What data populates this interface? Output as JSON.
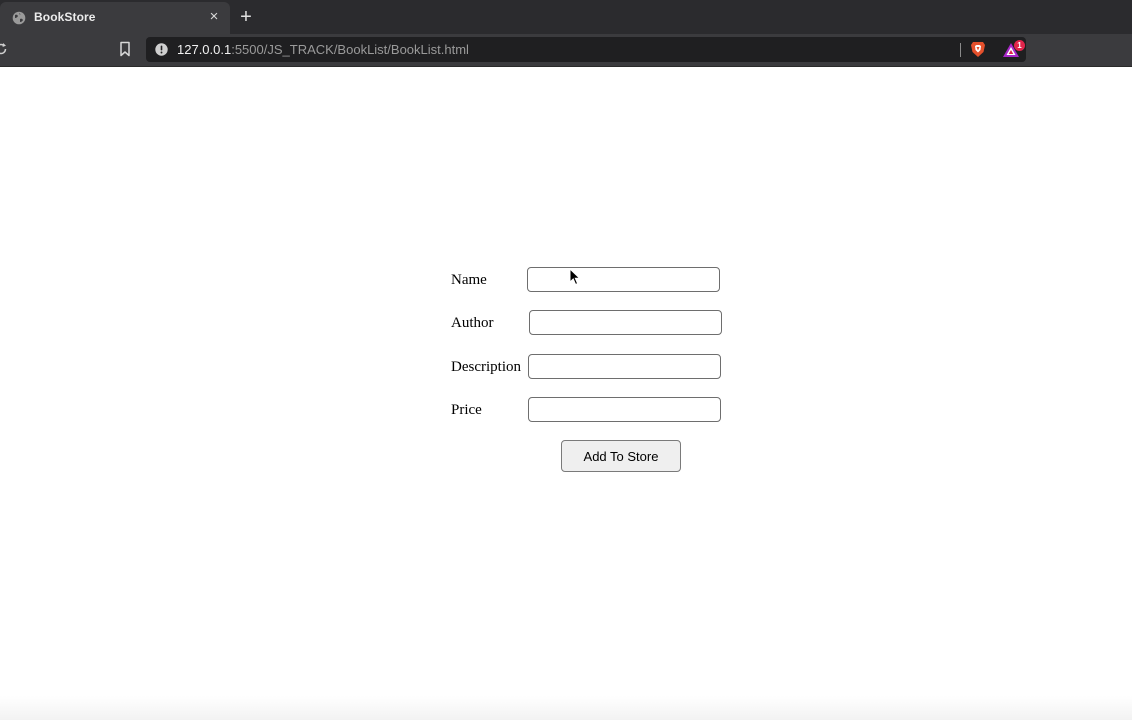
{
  "browser": {
    "tab": {
      "title": "BookStore",
      "close_glyph": "×",
      "favicon": "globe-icon"
    },
    "new_tab_glyph": "+",
    "url": {
      "host": "127.0.0.1",
      "rest": ":5500/JS_TRACK/BookList/BookList.html"
    },
    "rewards_badge": "1",
    "icons": [
      "reload-icon",
      "bookmark-icon",
      "info-icon",
      "brave-shield-icon",
      "brave-rewards-icon"
    ]
  },
  "form": {
    "fields": [
      {
        "label": "Name",
        "value": "",
        "placeholder": ""
      },
      {
        "label": "Author",
        "value": "",
        "placeholder": ""
      },
      {
        "label": "Description",
        "value": "",
        "placeholder": ""
      },
      {
        "label": "Price",
        "value": "",
        "placeholder": ""
      }
    ],
    "submit_label": "Add To Store"
  },
  "colors": {
    "chrome_dark": "#2b2b2e",
    "chrome_tab": "#3b3b3e",
    "urlbar": "#1f1f21",
    "brave_orange": "#e5502c",
    "badge_red": "#e0254b"
  }
}
